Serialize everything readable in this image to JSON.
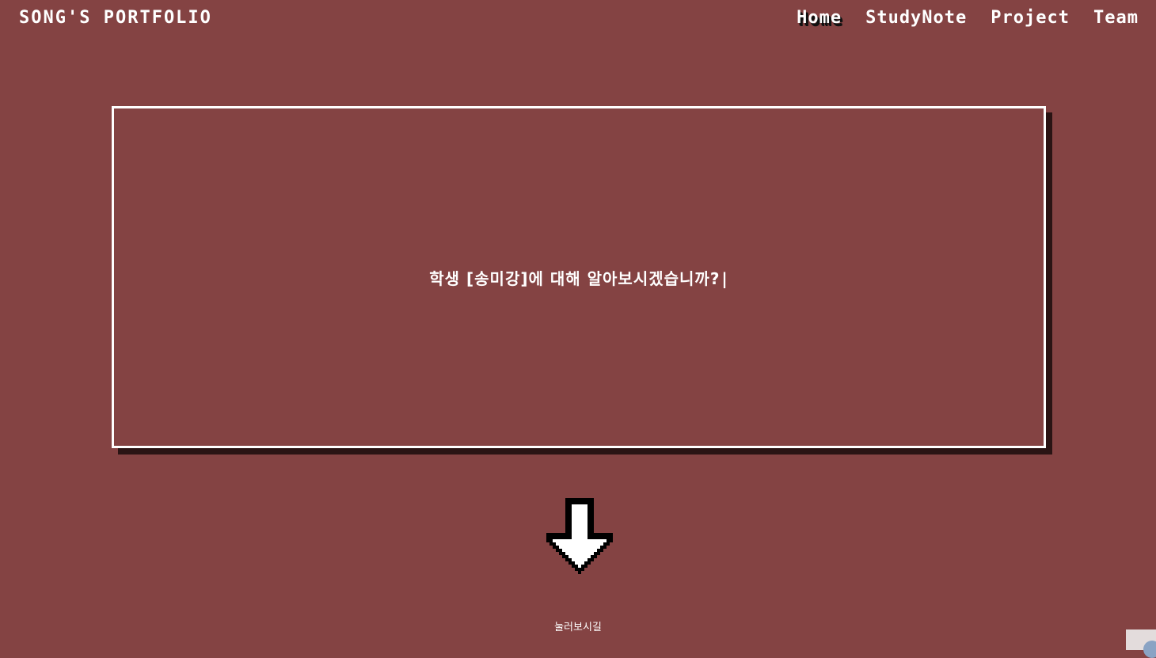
{
  "header": {
    "brand": "SONG'S PORTFOLIO",
    "nav": [
      {
        "label": "Home",
        "active": true
      },
      {
        "label": "StudyNote",
        "active": false
      },
      {
        "label": "Project",
        "active": false
      },
      {
        "label": "Team",
        "active": false
      }
    ]
  },
  "hero": {
    "text": "학생 [송미강]에 대해 알아보시겠습니까?",
    "cursor": "|"
  },
  "scroll": {
    "icon": "arrow-down-icon",
    "hint": "눌러보시길"
  },
  "colors": {
    "background": "#844343",
    "foreground": "#ffffff",
    "shadow": "#2a1414"
  }
}
